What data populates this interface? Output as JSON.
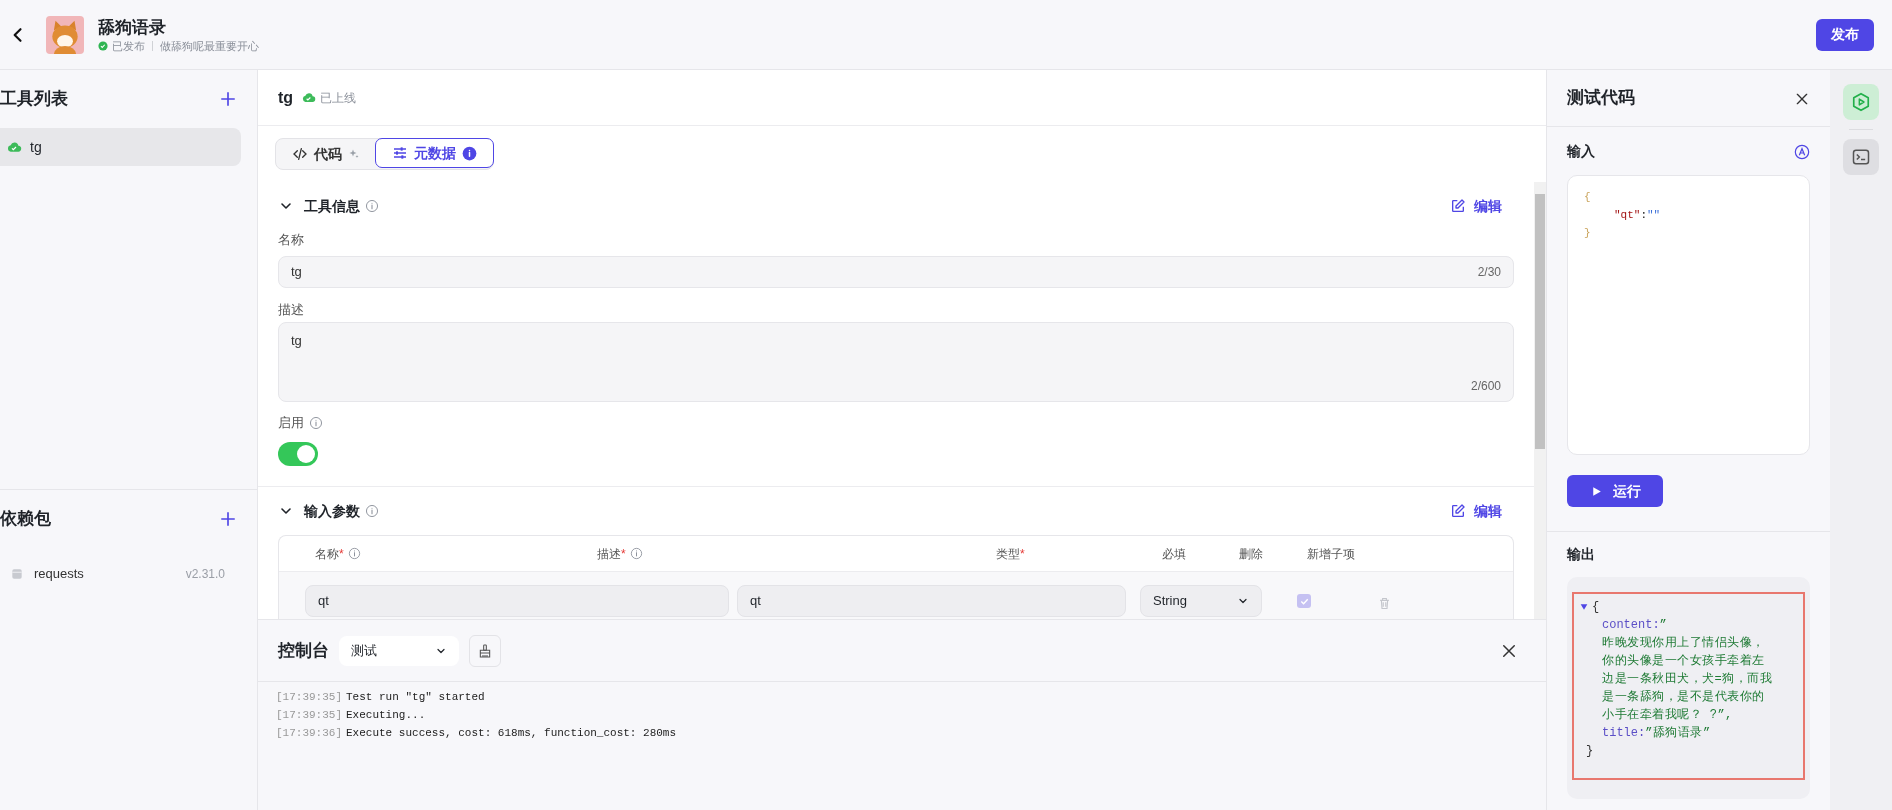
{
  "header": {
    "title": "舔狗语录",
    "status": "已发布",
    "published": true,
    "description": "做舔狗呢最重要开心",
    "publish_button": "发布"
  },
  "sidebar": {
    "tools_title": "工具列表",
    "tools": [
      {
        "name": "tg",
        "online": true,
        "selected": true
      }
    ],
    "deps_title": "依赖包",
    "packages": [
      {
        "name": "requests",
        "version": "v2.31.0"
      }
    ]
  },
  "editor": {
    "tool_name": "tg",
    "tool_status": "已上线",
    "tabs": [
      {
        "label": "代码",
        "kind": "code",
        "selected": false
      },
      {
        "label": "元数据",
        "kind": "meta",
        "selected": true
      }
    ],
    "tool_info": {
      "title": "工具信息",
      "expanded": true,
      "edit": "编辑",
      "name_label": "名称",
      "name_value": "tg",
      "name_count": "2/30",
      "desc_label": "描述",
      "desc_value": "tg",
      "desc_count": "2/600",
      "enabled_label": "启用",
      "enabled": true
    },
    "params": {
      "title": "输入参数",
      "expanded": true,
      "edit": "编辑",
      "columns": [
        {
          "label": "名称",
          "required_mark": "*",
          "info": true
        },
        {
          "label": "描述",
          "required_mark": "*",
          "info": true
        },
        {
          "label": "类型",
          "required_mark": "*",
          "info": false
        },
        {
          "label": "必填",
          "info": false
        },
        {
          "label": "删除",
          "info": false
        },
        {
          "label": "新增子项",
          "info": false
        }
      ],
      "rows": [
        {
          "name": "qt",
          "description": "qt",
          "type": "String",
          "required": true
        }
      ]
    }
  },
  "console": {
    "title": "控制台",
    "env": "测试",
    "logs": [
      {
        "time": "[17:39:35]",
        "message": "Test run \"tg\" started"
      },
      {
        "time": "[17:39:35]",
        "message": "Executing..."
      },
      {
        "time": "[17:39:36]",
        "message": "Execute success, cost: 618ms, function_cost: 280ms"
      }
    ]
  },
  "test_panel": {
    "title": "测试代码",
    "input_label": "输入",
    "input": {
      "open": "{",
      "key": "\"qt\"",
      "colon": ":",
      "value": "\"\"",
      "close": "}"
    },
    "run_button": "运行",
    "output_label": "输出",
    "output": {
      "expanded": true,
      "open": "{",
      "fields": [
        {
          "key": "content:",
          "value": "”",
          "lines": [
            "昨晚发现你用上了情侣头像，",
            "你的头像是一个女孩手牵着左",
            "边是一条秋田犬，犬=狗，而我",
            "是一条舔狗，是不是代表你的",
            "小手在牵着我呢？ ?”,"
          ]
        },
        {
          "key": "title:",
          "value": "”舔狗语录”"
        }
      ],
      "close": "}"
    }
  },
  "rail": [
    {
      "kind": "test",
      "selected": true
    },
    {
      "kind": "console",
      "selected": false
    }
  ]
}
